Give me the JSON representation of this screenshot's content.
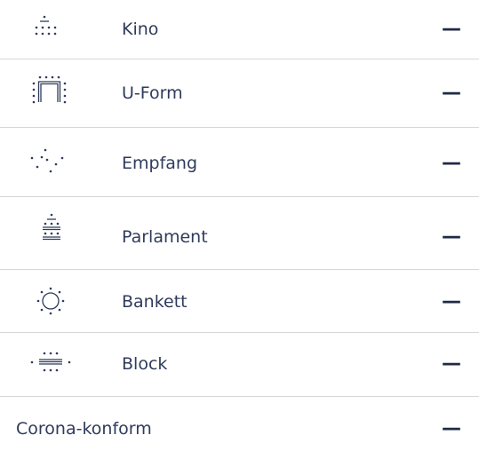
{
  "rows": [
    {
      "label": "Kino",
      "value": "—",
      "icon": "cinema-seating-icon"
    },
    {
      "label": "U-Form",
      "value": "—",
      "icon": "u-shape-seating-icon"
    },
    {
      "label": "Empfang",
      "value": "—",
      "icon": "reception-seating-icon"
    },
    {
      "label": "Parlament",
      "value": "—",
      "icon": "parliament-seating-icon"
    },
    {
      "label": "Bankett",
      "value": "—",
      "icon": "banquet-seating-icon"
    },
    {
      "label": "Block",
      "value": "—",
      "icon": "block-seating-icon"
    },
    {
      "label": "Corona-konform",
      "value": "—"
    }
  ],
  "colors": {
    "text": "#2f3b5c",
    "divider": "#d7d7d7",
    "icon": "#2f3b5c"
  }
}
